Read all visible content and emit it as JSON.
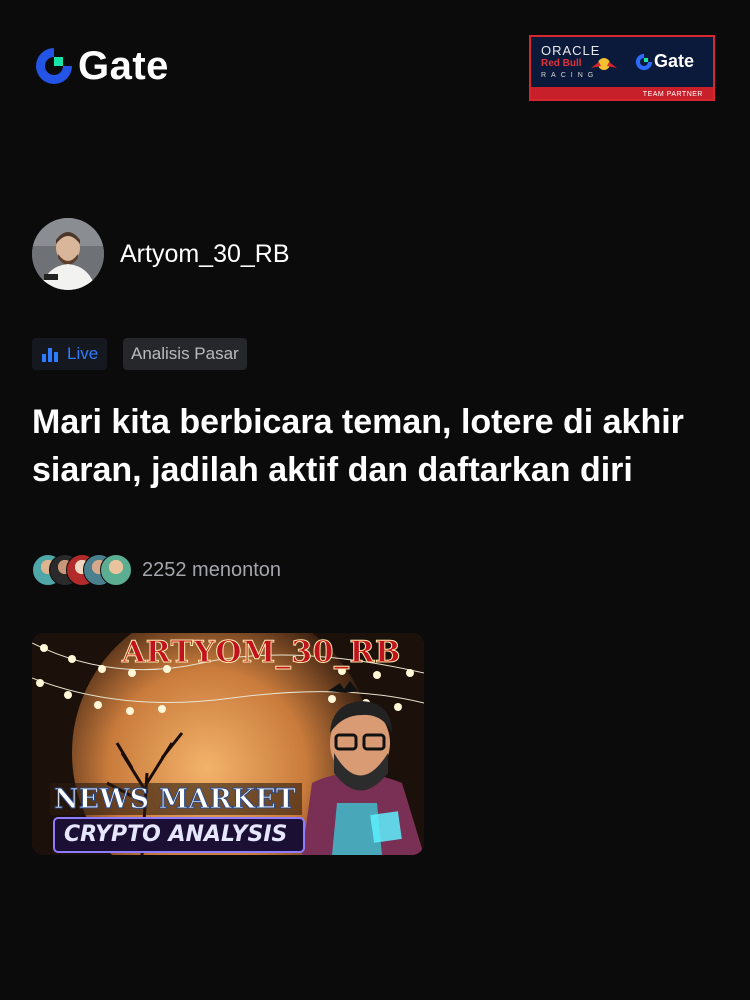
{
  "header": {
    "logo_text": "Gate",
    "partner_badge": {
      "line1": "ORACLE",
      "line2": "Red Bull",
      "line3": "RACING",
      "brand": "Gate",
      "caption": "TEAM PARTNER"
    }
  },
  "author": {
    "name": "Artyom_30_RB"
  },
  "tags": {
    "live_label": "Live",
    "category": "Analisis Pasar"
  },
  "post": {
    "title": "Mari kita berbicara teman, lotere di akhir siaran, jadilah aktif dan daftarkan diri",
    "viewers_text": "2252 menonton"
  },
  "thumbnail": {
    "headline": "ARTYOM_30_RB",
    "banner_top": "NEWS MARKET",
    "banner_bottom": "CRYPTO ANALYSIS"
  },
  "colors": {
    "background": "#0b0b0c",
    "accent_blue": "#2f7bff",
    "logo_blue": "#2354e6",
    "logo_green": "#17e5a7",
    "thumb_title_red": "#c1121f"
  }
}
